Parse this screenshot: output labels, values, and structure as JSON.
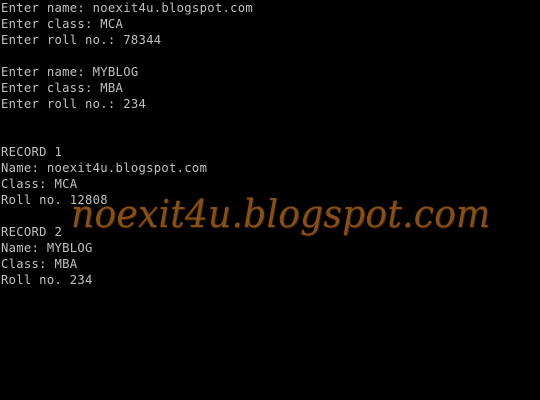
{
  "console": {
    "background": "#000000",
    "text_color": "#c0c0c0",
    "input_block_1": {
      "name_line": "Enter name: noexit4u.blogspot.com",
      "class_line": "Enter class: MCA",
      "roll_line": "Enter roll no.: 78344"
    },
    "input_block_2": {
      "name_line": "Enter name: MYBLOG",
      "class_line": "Enter class: MBA",
      "roll_line": "Enter roll no.: 234"
    },
    "record_1": {
      "header": "RECORD 1",
      "name_line": "Name: noexit4u.blogspot.com",
      "class_line": "Class: MCA",
      "roll_line": "Roll no. 12808"
    },
    "record_2": {
      "header": "RECORD 2",
      "name_line": "Name: MYBLOG",
      "class_line": "Class: MBA",
      "roll_line": "Roll no. 234"
    }
  },
  "watermark": {
    "text": "noexit4u.blogspot.com",
    "color": "#d9822b"
  }
}
